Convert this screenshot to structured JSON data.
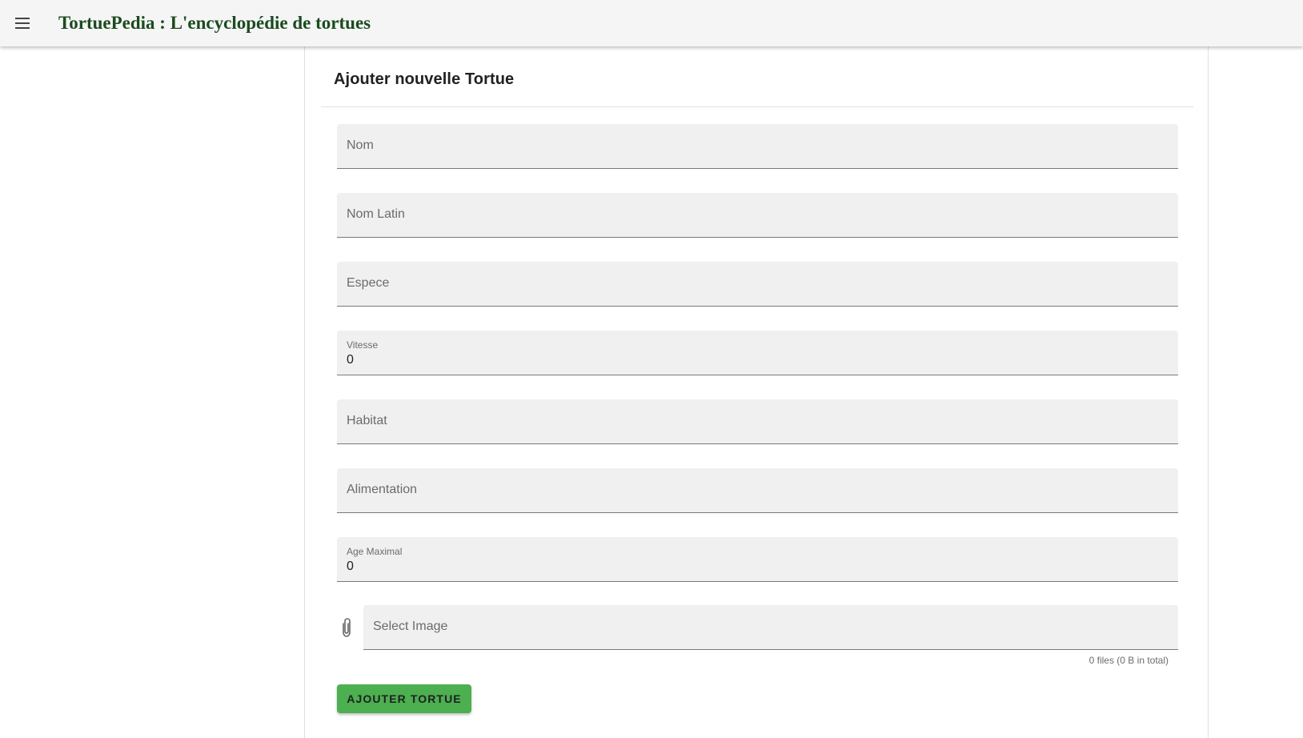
{
  "appbar": {
    "menu_icon": "hamburger-menu-icon",
    "title": "TortuePedia : L'encyclopédie de tortues"
  },
  "form": {
    "title": "Ajouter nouvelle Tortue",
    "fields": {
      "nom": {
        "label": "Nom",
        "value": ""
      },
      "nom_latin": {
        "label": "Nom Latin",
        "value": ""
      },
      "espece": {
        "label": "Espece",
        "value": ""
      },
      "vitesse": {
        "label": "Vitesse",
        "value": "0"
      },
      "habitat": {
        "label": "Habitat",
        "value": ""
      },
      "alimentation": {
        "label": "Alimentation",
        "value": ""
      },
      "age_maximal": {
        "label": "Age Maximal",
        "value": "0"
      }
    },
    "image_input": {
      "icon": "paperclip-icon",
      "label": "Select Image",
      "hint": "0 files (0 B in total)"
    },
    "submit_label": "AJOUTER TORTUE"
  },
  "colors": {
    "appbar_bg": "#f5f5f5",
    "title_color": "#1b4b1f",
    "field_bg": "#f0f0f0",
    "button_bg": "#4caf50"
  }
}
